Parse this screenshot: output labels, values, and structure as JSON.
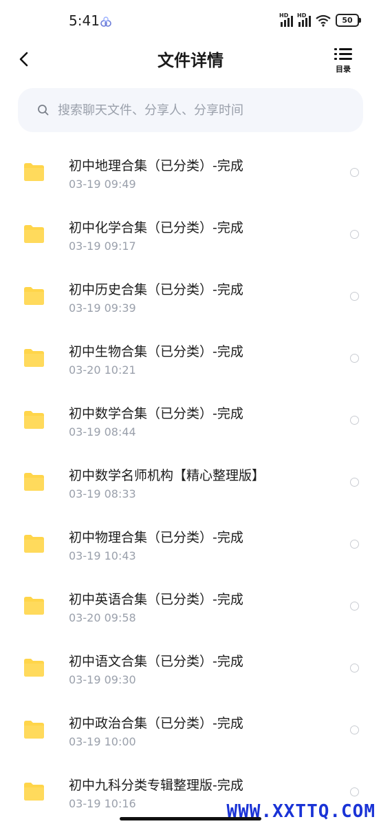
{
  "status_bar": {
    "time": "5:41",
    "battery": "50",
    "signal_badge": "HD"
  },
  "header": {
    "title": "文件详情",
    "toc_label": "目录"
  },
  "search": {
    "placeholder": "搜索聊天文件、分享人、分享时间"
  },
  "files": [
    {
      "name": "初中地理合集（已分类）-完成",
      "date": "03-19  09:49"
    },
    {
      "name": "初中化学合集（已分类）-完成",
      "date": "03-19  09:17"
    },
    {
      "name": "初中历史合集（已分类）-完成",
      "date": "03-19  09:39"
    },
    {
      "name": "初中生物合集（已分类）-完成",
      "date": "03-20  10:21"
    },
    {
      "name": "初中数学合集（已分类）-完成",
      "date": "03-19  08:44"
    },
    {
      "name": "初中数学名师机构【精心整理版】",
      "date": "03-19  08:33"
    },
    {
      "name": "初中物理合集（已分类）-完成",
      "date": "03-19  10:43"
    },
    {
      "name": "初中英语合集（已分类）-完成",
      "date": "03-20  09:58"
    },
    {
      "name": "初中语文合集（已分类）-完成",
      "date": "03-19  09:30"
    },
    {
      "name": "初中政治合集（已分类）-完成",
      "date": "03-19  10:00"
    },
    {
      "name": "初中九科分类专辑整理版-完成",
      "date": "03-19  10:16"
    }
  ],
  "watermark": "WWW.XXTTQ.COM",
  "colors": {
    "folder": "#FFD54A",
    "search_bg": "#F4F6FB",
    "secondary_text": "#9AA0AB",
    "watermark": "#1A33D6"
  }
}
